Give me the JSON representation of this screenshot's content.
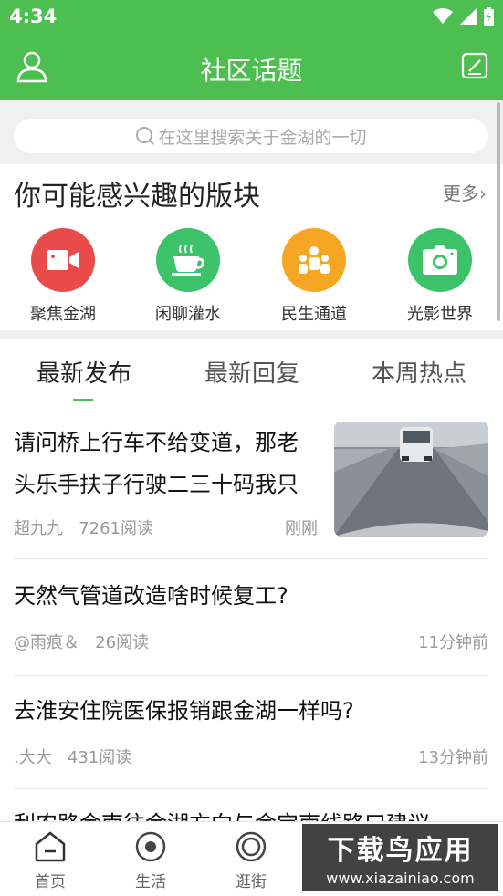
{
  "status": {
    "time": "4:34"
  },
  "header": {
    "title": "社区话题"
  },
  "search": {
    "placeholder": "在这里搜索关于金湖的一切"
  },
  "section": {
    "title": "你可能感兴趣的版块",
    "more": "更多"
  },
  "boards": [
    {
      "label": "聚焦金湖",
      "icon": "video-camera-icon",
      "color": "#e94b4b"
    },
    {
      "label": "闲聊灌水",
      "icon": "coffee-cup-icon",
      "color": "#3cc36a"
    },
    {
      "label": "民生通道",
      "icon": "people-icon",
      "color": "#f5a623"
    },
    {
      "label": "光影世界",
      "icon": "camera-icon",
      "color": "#3cc36a"
    }
  ],
  "tabs": [
    {
      "label": "最新发布"
    },
    {
      "label": "最新回复"
    },
    {
      "label": "本周热点"
    }
  ],
  "posts": [
    {
      "title": "请问桥上行车不给变道，那老头乐手扶子行驶二三十码我只能跟着？",
      "author": "超九九",
      "reads": "7261阅读",
      "time": "刚刚"
    },
    {
      "title": "天然气管道改造啥时候复工?",
      "author": "@雨痕＆",
      "reads": "26阅读",
      "time": "11分钟前"
    },
    {
      "title": "去淮安住院医保报销跟金湖一样吗?",
      "author": ".大大",
      "reads": "431阅读",
      "time": "13分钟前"
    },
    {
      "title": "利农路金南往金湖方向与金宝南线路口建议"
    }
  ],
  "nav": [
    {
      "label": "首页"
    },
    {
      "label": "生活"
    },
    {
      "label": "逛街"
    }
  ],
  "watermark": {
    "line1": "下载鸟应用",
    "line2": "www.xiazainiao.com"
  },
  "colors": {
    "brand": "#4cbf50"
  }
}
